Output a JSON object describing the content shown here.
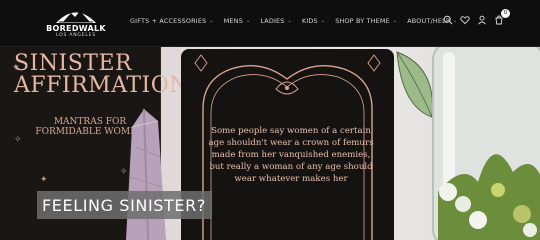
{
  "brand": {
    "name": "BOREDWALK",
    "location": "LOS ANGELES"
  },
  "nav": {
    "items": [
      {
        "label": "GIFTS + ACCESSORIES"
      },
      {
        "label": "MENS"
      },
      {
        "label": "LADIES"
      },
      {
        "label": "KIDS"
      },
      {
        "label": "SHOP BY THEME"
      },
      {
        "label": "ABOUT/HELP"
      }
    ]
  },
  "header_icons": [
    "search-icon",
    "heart-icon",
    "user-icon",
    "cart-icon"
  ],
  "cart": {
    "count": "0"
  },
  "hero": {
    "box_title": "SINISTER AFFIRMATIONS",
    "box_subtitle": "MANTRAS FOR FORMIDABLE WOMEN",
    "card_quote": "Some people say women of a certain age shouldn't wear a crown of femurs made from her vanquished enemies, but really a woman of any age should wear whatever makes her",
    "headline": "FEELING SINISTER?",
    "colors": {
      "accent": "#e9c1ac",
      "dark": "#151212"
    }
  }
}
